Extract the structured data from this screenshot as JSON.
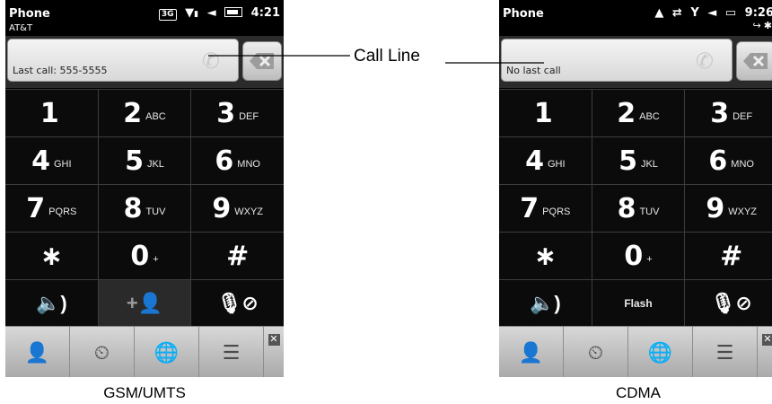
{
  "callout": {
    "label": "Call Line"
  },
  "gsm": {
    "caption": "GSM/UMTS",
    "status": {
      "title": "Phone",
      "carrier": "AT&T",
      "net": "3G",
      "signal": "▼",
      "time": "4:21"
    },
    "call_line": {
      "text": "Last call: 555-5555"
    },
    "keys": [
      [
        {
          "d": "1",
          "l": ""
        },
        {
          "d": "2",
          "l": "ABC"
        },
        {
          "d": "3",
          "l": "DEF"
        }
      ],
      [
        {
          "d": "4",
          "l": "GHI"
        },
        {
          "d": "5",
          "l": "JKL"
        },
        {
          "d": "6",
          "l": "MNO"
        }
      ],
      [
        {
          "d": "7",
          "l": "PQRS"
        },
        {
          "d": "8",
          "l": "TUV"
        },
        {
          "d": "9",
          "l": "WXYZ"
        }
      ],
      [
        {
          "d": "∗",
          "l": ""
        },
        {
          "d": "0",
          "l": "+"
        },
        {
          "d": "#",
          "l": ""
        }
      ]
    ],
    "function_row": {
      "speaker": "🔈)",
      "add": "+👤",
      "mute": "🎙⊘"
    }
  },
  "cdma": {
    "caption": "CDMA",
    "status": {
      "title": "Phone",
      "time": "9:26"
    },
    "call_line": {
      "text": "No last call"
    },
    "keys": [
      [
        {
          "d": "1",
          "l": ""
        },
        {
          "d": "2",
          "l": "ABC"
        },
        {
          "d": "3",
          "l": "DEF"
        }
      ],
      [
        {
          "d": "4",
          "l": "GHI"
        },
        {
          "d": "5",
          "l": "JKL"
        },
        {
          "d": "6",
          "l": "MNO"
        }
      ],
      [
        {
          "d": "7",
          "l": "PQRS"
        },
        {
          "d": "8",
          "l": "TUV"
        },
        {
          "d": "9",
          "l": "WXYZ"
        }
      ],
      [
        {
          "d": "∗",
          "l": ""
        },
        {
          "d": "0",
          "l": "+"
        },
        {
          "d": "#",
          "l": ""
        }
      ]
    ],
    "function_row": {
      "speaker": "🔈)",
      "flash": "Flash",
      "mute": "🎙⊘"
    }
  },
  "bottom_tabs": {
    "contacts": "👤",
    "call_history": "⏲",
    "speed_dial": "🌐",
    "notes": "☰",
    "close": "✕"
  }
}
